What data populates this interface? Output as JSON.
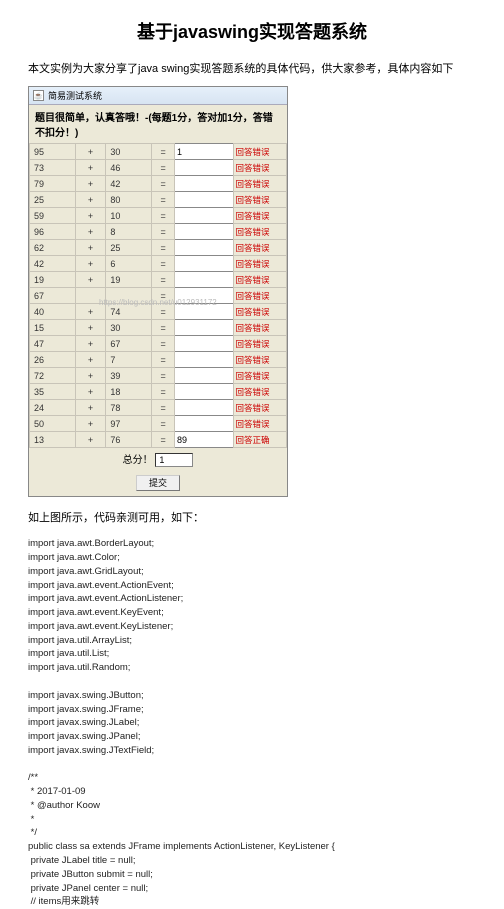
{
  "page": {
    "title": "基于javaswing实现答题系统",
    "intro": "本文实例为大家分享了java swing实现答题系统的具体代码，供大家参考，具体内容如下",
    "caption": "如上图所示，代码亲测可用，如下："
  },
  "window": {
    "title": "简易测试系统",
    "instruction": "题目很简单，认真答哦！-(每题1分，答对加1分，答错不扣分！)",
    "scoreLabel": "总分！",
    "scoreValue": "1",
    "submitLabel": "提交",
    "watermark": "https://blog.csdn.net/u012931172"
  },
  "rows": [
    {
      "a": "95",
      "op": "+",
      "b": "30",
      "ans": "1",
      "res": "回答错误",
      "ok": false
    },
    {
      "a": "73",
      "op": "+",
      "b": "46",
      "ans": "",
      "res": "回答错误",
      "ok": false
    },
    {
      "a": "79",
      "op": "+",
      "b": "42",
      "ans": "",
      "res": "回答错误",
      "ok": false
    },
    {
      "a": "25",
      "op": "+",
      "b": "80",
      "ans": "",
      "res": "回答错误",
      "ok": false
    },
    {
      "a": "59",
      "op": "+",
      "b": "10",
      "ans": "",
      "res": "回答错误",
      "ok": false
    },
    {
      "a": "96",
      "op": "+",
      "b": "8",
      "ans": "",
      "res": "回答错误",
      "ok": false
    },
    {
      "a": "62",
      "op": "+",
      "b": "25",
      "ans": "",
      "res": "回答错误",
      "ok": false
    },
    {
      "a": "42",
      "op": "+",
      "b": "6",
      "ans": "",
      "res": "回答错误",
      "ok": false
    },
    {
      "a": "19",
      "op": "+",
      "b": "19",
      "ans": "",
      "res": "回答错误",
      "ok": false
    },
    {
      "a": "67",
      "op": "",
      "b": "",
      "ans": "",
      "res": "回答错误",
      "ok": false
    },
    {
      "a": "40",
      "op": "+",
      "b": "74",
      "ans": "",
      "res": "回答错误",
      "ok": false
    },
    {
      "a": "15",
      "op": "+",
      "b": "30",
      "ans": "",
      "res": "回答错误",
      "ok": false
    },
    {
      "a": "47",
      "op": "+",
      "b": "67",
      "ans": "",
      "res": "回答错误",
      "ok": false
    },
    {
      "a": "26",
      "op": "+",
      "b": "7",
      "ans": "",
      "res": "回答错误",
      "ok": false
    },
    {
      "a": "72",
      "op": "+",
      "b": "39",
      "ans": "",
      "res": "回答错误",
      "ok": false
    },
    {
      "a": "35",
      "op": "+",
      "b": "18",
      "ans": "",
      "res": "回答错误",
      "ok": false
    },
    {
      "a": "24",
      "op": "+",
      "b": "78",
      "ans": "",
      "res": "回答错误",
      "ok": false
    },
    {
      "a": "50",
      "op": "+",
      "b": "97",
      "ans": "",
      "res": "回答错误",
      "ok": false
    },
    {
      "a": "13",
      "op": "+",
      "b": "76",
      "ans": "89",
      "res": "回答正确",
      "ok": true
    }
  ],
  "code": "import java.awt.BorderLayout;\nimport java.awt.Color;\nimport java.awt.GridLayout;\nimport java.awt.event.ActionEvent;\nimport java.awt.event.ActionListener;\nimport java.awt.event.KeyEvent;\nimport java.awt.event.KeyListener;\nimport java.util.ArrayList;\nimport java.util.List;\nimport java.util.Random;\n\nimport javax.swing.JButton;\nimport javax.swing.JFrame;\nimport javax.swing.JLabel;\nimport javax.swing.JPanel;\nimport javax.swing.JTextField;\n\n/**\n * 2017-01-09\n * @author Koow\n *\n */\npublic class sa extends JFrame implements ActionListener, KeyListener {\n private JLabel title = null;\n private JButton submit = null;\n private JPanel center = null;\n // items用来跳转"
}
